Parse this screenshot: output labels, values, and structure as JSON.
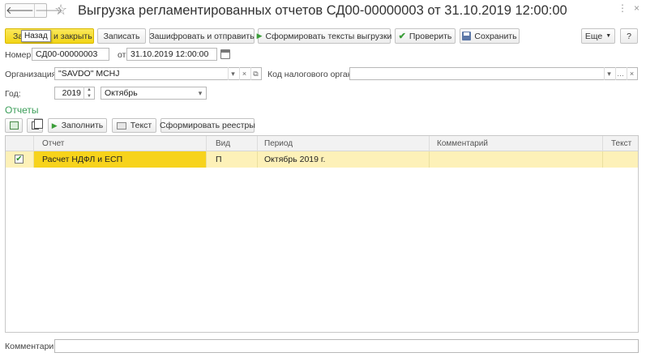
{
  "window": {
    "title": "Выгрузка регламентированных отчетов СД00-00000003 от 31.10.2019 12:00:00",
    "back_icon": "arrow-left-icon",
    "forward_icon": "arrow-right-icon",
    "favorite_icon": "star-icon"
  },
  "toolbar": {
    "post_close_prefix": "За",
    "post_close_suffix": "и закрыть",
    "tooltip": "Назад",
    "save_label": "Записать",
    "encrypt_send_label": "Зашифровать и отправить",
    "generate_texts_label": "Сформировать тексты выгрузки",
    "check_label": "Проверить",
    "save_file_label": "Сохранить",
    "more_label": "Еще",
    "help_label": "?"
  },
  "form": {
    "number_label": "Номер:",
    "number_value": "СД00-00000003",
    "date_label": "от:",
    "date_value": "31.10.2019 12:00:00",
    "org_label": "Организация:",
    "org_value": "\"SAVDO\" MCHJ",
    "tax_label": "Код налогового органа:",
    "tax_value": "",
    "year_label": "Год:",
    "year_value": "2019",
    "month_value": "Октябрь"
  },
  "reports": {
    "section_title": "Отчеты",
    "fill_label": "Заполнить",
    "text_label": "Текст",
    "registries_label": "Сформировать реестры",
    "columns": [
      "Отчет",
      "Вид",
      "Период",
      "Комментарий",
      "Текст"
    ],
    "rows": [
      {
        "checked": true,
        "report": "Расчет НДФЛ и ЕСП",
        "kind": "П",
        "period": "Октябрь 2019 г.",
        "comment": "",
        "text": ""
      }
    ]
  },
  "footer": {
    "comment_label": "Комментарий:",
    "comment_value": ""
  },
  "colors": {
    "primary_button": "#f2d516",
    "row_highlight": "#fdf1b8",
    "current_cell": "#f7d31b",
    "section_title": "#3a9d58"
  }
}
